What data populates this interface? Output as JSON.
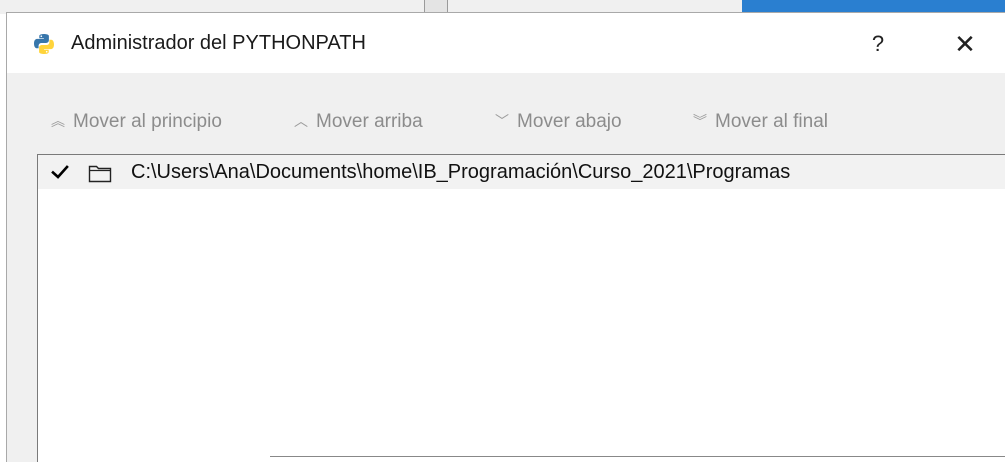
{
  "dialog": {
    "title": "Administrador del PYTHONPATH",
    "help_label": "?",
    "close_label": "✕"
  },
  "toolbar": {
    "move_top_label": "Mover al principio",
    "move_up_label": "Mover arriba",
    "move_down_label": "Mover abajo",
    "move_bottom_label": "Mover al final"
  },
  "paths": [
    {
      "path": "C:\\Users\\Ana\\Documents\\home\\IB_Programación\\Curso_2021\\Programas",
      "checked": true
    }
  ],
  "colors": {
    "python_blue": "#3776ab",
    "python_yellow": "#ffd43b",
    "disabled_text": "#8c8c8c"
  }
}
